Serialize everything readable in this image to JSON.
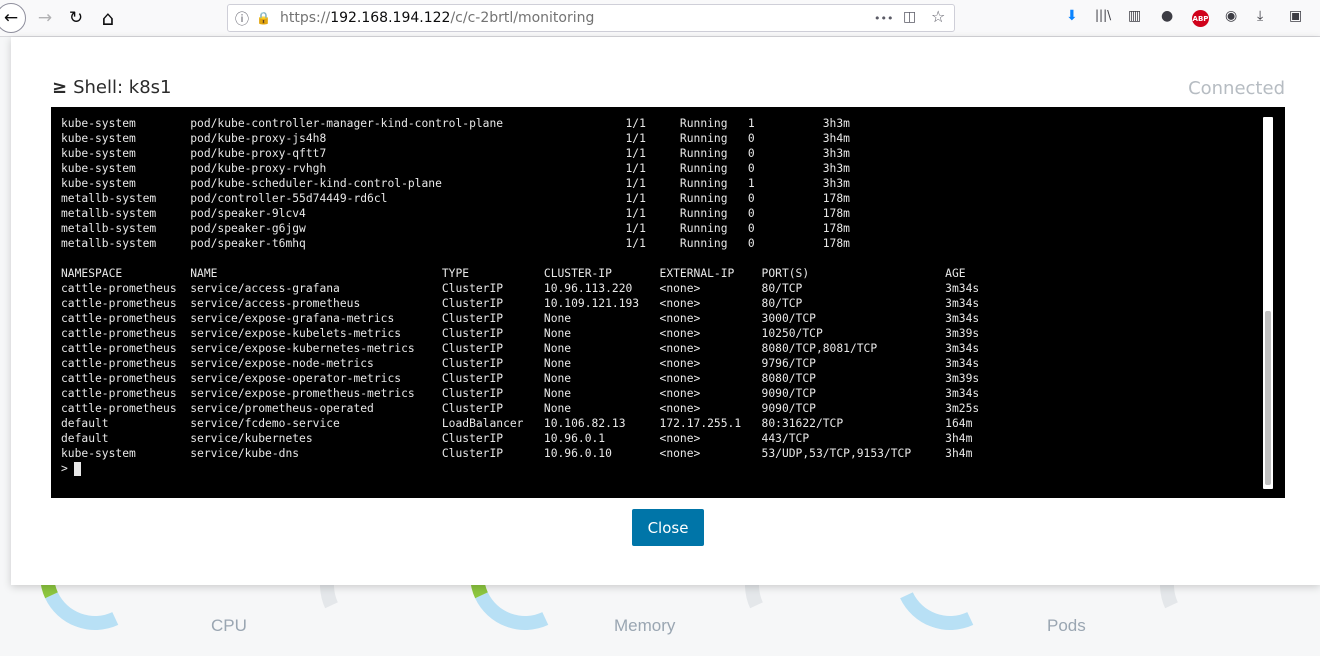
{
  "browser": {
    "url_prefix": "https://",
    "url_host": "192.168.194.122",
    "url_path": "/c/c-2brtl/monitoring",
    "icons": {
      "back": "←",
      "forward": "→",
      "reload": "↻",
      "home": "⌂",
      "info": "ⓘ",
      "lock": "🔒",
      "more": "•••",
      "pocket": "◫",
      "star": "☆",
      "download": "⬇",
      "library": "|||\\",
      "sidebar": "▥",
      "account": "●",
      "abp": "ABP",
      "ext": "◉",
      "download2": "⤓",
      "ext2": "▣"
    }
  },
  "dashboard": {
    "labels": [
      "CPU",
      "Memory",
      "Pods"
    ]
  },
  "modal": {
    "title_glyph": "≥",
    "title": "Shell: k8s1",
    "status": "Connected",
    "close_label": "Close"
  },
  "terminal": {
    "lines": [
      "kube-system        pod/kube-controller-manager-kind-control-plane                  1/1     Running   1          3h3m",
      "kube-system        pod/kube-proxy-js4h8                                            1/1     Running   0          3h4m",
      "kube-system        pod/kube-proxy-qftt7                                            1/1     Running   0          3h3m",
      "kube-system        pod/kube-proxy-rvhgh                                            1/1     Running   0          3h3m",
      "kube-system        pod/kube-scheduler-kind-control-plane                           1/1     Running   1          3h3m",
      "metallb-system     pod/controller-55d74449-rd6cl                                   1/1     Running   0          178m",
      "metallb-system     pod/speaker-9lcv4                                               1/1     Running   0          178m",
      "metallb-system     pod/speaker-g6jgw                                               1/1     Running   0          178m",
      "metallb-system     pod/speaker-t6mhq                                               1/1     Running   0          178m",
      "",
      "NAMESPACE          NAME                                 TYPE           CLUSTER-IP       EXTERNAL-IP    PORT(S)                    AGE",
      "cattle-prometheus  service/access-grafana               ClusterIP      10.96.113.220    <none>         80/TCP                     3m34s",
      "cattle-prometheus  service/access-prometheus            ClusterIP      10.109.121.193   <none>         80/TCP                     3m34s",
      "cattle-prometheus  service/expose-grafana-metrics       ClusterIP      None             <none>         3000/TCP                   3m34s",
      "cattle-prometheus  service/expose-kubelets-metrics      ClusterIP      None             <none>         10250/TCP                  3m39s",
      "cattle-prometheus  service/expose-kubernetes-metrics    ClusterIP      None             <none>         8080/TCP,8081/TCP          3m34s",
      "cattle-prometheus  service/expose-node-metrics          ClusterIP      None             <none>         9796/TCP                   3m34s",
      "cattle-prometheus  service/expose-operator-metrics      ClusterIP      None             <none>         8080/TCP                   3m39s",
      "cattle-prometheus  service/expose-prometheus-metrics    ClusterIP      None             <none>         9090/TCP                   3m34s",
      "cattle-prometheus  service/prometheus-operated          ClusterIP      None             <none>         9090/TCP                   3m25s",
      "default            service/fcdemo-service               LoadBalancer   10.106.82.13     172.17.255.1   80:31622/TCP               164m",
      "default            service/kubernetes                   ClusterIP      10.96.0.1        <none>         443/TCP                    3h4m",
      "kube-system        service/kube-dns                     ClusterIP      10.96.0.10       <none>         53/UDP,53/TCP,9153/TCP     3h4m"
    ],
    "prompt": ">"
  }
}
